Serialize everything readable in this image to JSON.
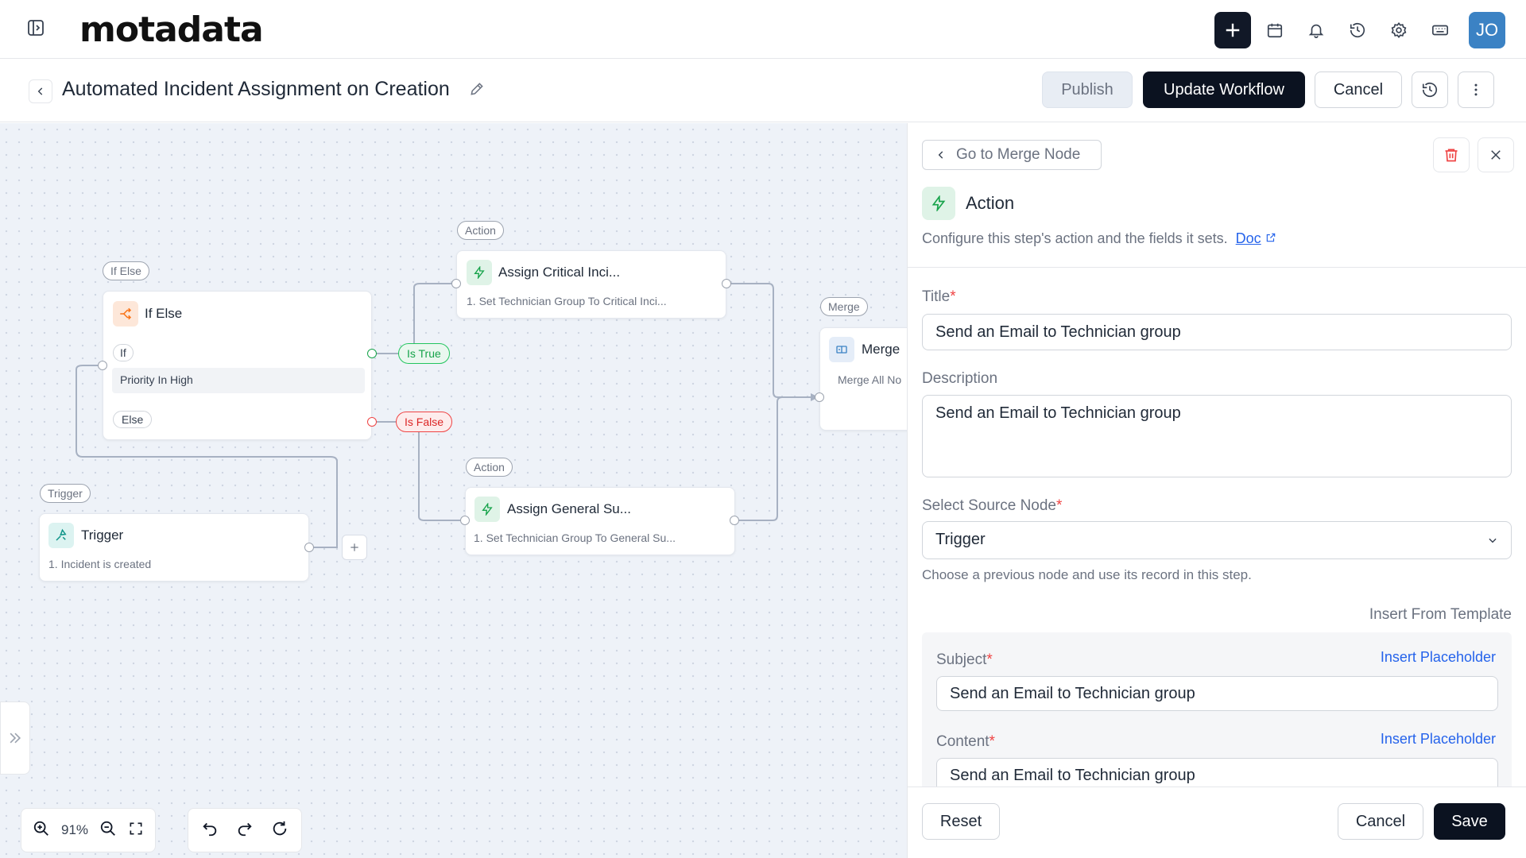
{
  "topbar": {
    "logo_text": "motadata",
    "avatar_initials": "JO",
    "icons": [
      "sidebar-toggle-icon",
      "plus-icon",
      "calendar-icon",
      "bell-icon",
      "history-icon",
      "gear-icon",
      "keyboard-icon"
    ]
  },
  "header": {
    "title": "Automated Incident Assignment on Creation",
    "publish_label": "Publish",
    "update_label": "Update Workflow",
    "cancel_label": "Cancel"
  },
  "canvas": {
    "nodes": {
      "ifelse": {
        "tag": "If Else",
        "title": "If Else",
        "if_label": "If",
        "condition": "Priority In High",
        "else_label": "Else"
      },
      "critical": {
        "tag": "Action",
        "title": "Assign Critical Inci...",
        "sub": "1. Set Technician Group To Critical Inci..."
      },
      "general": {
        "tag": "Action",
        "title": "Assign General Su...",
        "sub": "1. Set Technician Group To General Su..."
      },
      "merge": {
        "tag": "Merge",
        "title": "Merge",
        "sub": "Merge All No"
      },
      "trigger": {
        "tag": "Trigger",
        "title": "Trigger",
        "sub": "1. Incident is created"
      }
    },
    "branches": {
      "true_label": "Is True",
      "false_label": "Is False"
    },
    "zoom": "91%"
  },
  "panel": {
    "goto_label": "Go to Merge Node",
    "action_title": "Action",
    "action_desc": "Configure this step's action and the fields it sets.",
    "doc_label": "Doc",
    "title_label": "Title",
    "title_value": "Send an Email to Technician group",
    "description_label": "Description",
    "description_value": "Send an Email to Technician group",
    "source_label": "Select Source Node",
    "source_value": "Trigger",
    "source_help": "Choose a previous node and use its record in this step.",
    "insert_template": "Insert From Template",
    "subject_label": "Subject",
    "subject_value": "Send an Email to Technician group",
    "content_label": "Content",
    "content_value": "Send an Email to Technician group",
    "insert_placeholder": "Insert Placeholder",
    "reset_label": "Reset",
    "cancel_label": "Cancel",
    "save_label": "Save"
  },
  "colors": {
    "accent_dark": "#0b1220",
    "link": "#2563eb",
    "true": "#16a34a",
    "false": "#dc2626",
    "avatar": "#3b82c4"
  }
}
